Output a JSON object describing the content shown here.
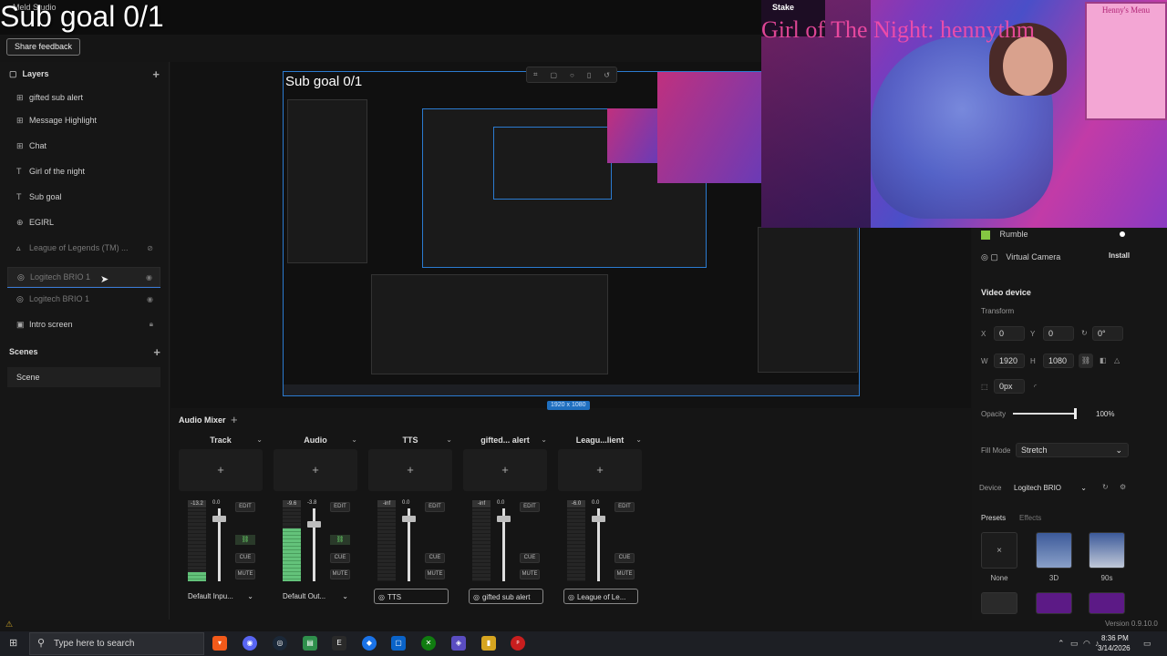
{
  "app": {
    "title": "Meld Studio",
    "overlay_title": "Sub goal 0/1",
    "feedback_button": "Share feedback"
  },
  "layers": {
    "title": "Layers",
    "items": [
      {
        "label": "gifted sub alert",
        "icon": "group-icon"
      },
      {
        "label": "Message Highlight",
        "icon": "group-icon"
      },
      {
        "label": "Chat",
        "icon": "group-icon"
      },
      {
        "label": "Girl of the night",
        "icon": "text-icon"
      },
      {
        "label": "Sub goal",
        "icon": "text-icon"
      },
      {
        "label": "EGIRL",
        "icon": "globe-icon"
      },
      {
        "label": "League of Legends (TM) ...",
        "icon": "game-icon"
      },
      {
        "label": "Logitech BRIO 1",
        "icon": "camera-icon"
      },
      {
        "label": "Logitech BRIO 1",
        "icon": "camera-icon"
      },
      {
        "label": "Intro screen",
        "icon": "image-icon"
      }
    ]
  },
  "scenes": {
    "title": "Scenes",
    "items": [
      {
        "label": "Scene"
      }
    ]
  },
  "canvas": {
    "resolution_badge": "1920 x 1080"
  },
  "cam_overlay": {
    "scrolling_text": "Girl of The Night: hennythm",
    "menu_title": "Henny's Menu",
    "stake_text": "Stake"
  },
  "right_panel": {
    "rumble_label": "Rumble",
    "virtual_camera_label": "Virtual Camera",
    "install_button": "Install",
    "section_title": "Video device",
    "transform_label": "Transform",
    "x_label": "X",
    "x_value": "0",
    "y_label": "Y",
    "y_value": "0",
    "rotation_value": "0°",
    "w_label": "W",
    "w_value": "1920",
    "h_label": "H",
    "h_value": "1080",
    "corner_value": "0px",
    "opacity_label": "Opacity",
    "opacity_value": "100%",
    "opacity_level": 1.0,
    "fill_mode_label": "Fill Mode",
    "fill_mode_value": "Stretch",
    "device_label": "Device",
    "device_value": "Logitech BRIO",
    "presets_tab": "Presets",
    "effects_tab": "Effects",
    "presets": [
      {
        "label": "None"
      },
      {
        "label": "3D"
      },
      {
        "label": "90s"
      }
    ]
  },
  "mixer": {
    "title": "Audio Mixer",
    "channels": [
      {
        "name": "Track",
        "meter_value": "-13.2",
        "fader_value": "0.0",
        "meter_level": 0.12,
        "fader_level": 0.9,
        "edit": "EDIT",
        "cue": "CUE",
        "mute": "MUTE",
        "device": "Default Inpu...",
        "device_style": "dropdown",
        "linked": true
      },
      {
        "name": "Audio",
        "meter_value": "-9.6",
        "fader_value": "-3.8",
        "meter_level": 0.72,
        "fader_level": 0.82,
        "edit": "EDIT",
        "cue": "CUE",
        "mute": "MUTE",
        "device": "Default Out...",
        "device_style": "dropdown",
        "linked": true
      },
      {
        "name": "TTS",
        "meter_value": "-inf",
        "fader_value": "0.0",
        "meter_level": 0.0,
        "fader_level": 0.9,
        "edit": "EDIT",
        "cue": "CUE",
        "mute": "MUTE",
        "device": "TTS",
        "device_style": "outlined",
        "linked": false
      },
      {
        "name": "gifted... alert",
        "meter_value": "-inf",
        "fader_value": "0.0",
        "meter_level": 0.0,
        "fader_level": 0.9,
        "edit": "EDIT",
        "cue": "CUE",
        "mute": "MUTE",
        "device": "gifted sub alert",
        "device_style": "outlined",
        "linked": false
      },
      {
        "name": "Leagu...lient",
        "meter_value": "-6.0",
        "fader_value": "0.0",
        "meter_level": 0.0,
        "fader_level": 0.9,
        "edit": "EDIT",
        "cue": "CUE",
        "mute": "MUTE",
        "device": "League of Le...",
        "device_style": "outlined",
        "linked": false
      }
    ]
  },
  "status": {
    "version": "Version 0.9.10.0"
  },
  "taskbar": {
    "search_placeholder": "Type here to search",
    "time": "8:36 PM",
    "date": "3/14/2026",
    "apps": [
      "brave",
      "discord",
      "steam",
      "meld",
      "epic",
      "vpn",
      "notes",
      "xbox",
      "riot",
      "files",
      "pdf"
    ]
  }
}
